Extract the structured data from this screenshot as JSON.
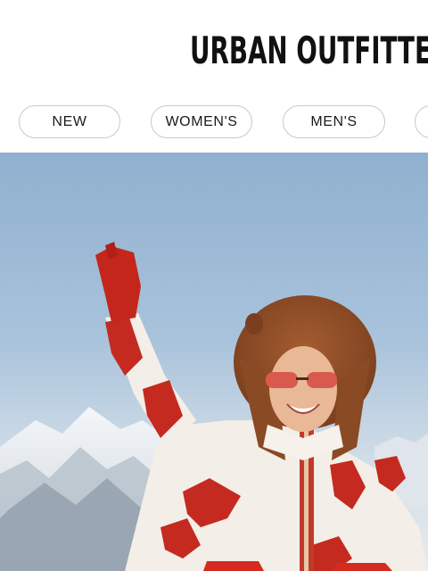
{
  "brand": {
    "logo_text": "URBAN OUTFITTERS"
  },
  "nav": {
    "items": [
      {
        "label": "NEW"
      },
      {
        "label": "WOMEN'S"
      },
      {
        "label": "MEN'S"
      },
      {
        "label": ""
      }
    ]
  },
  "hero": {
    "image": "woman-in-fur-hat-waving-snowy-mountains",
    "sky_color": "#8fb3d4",
    "accent_color": "#d42a1f"
  }
}
